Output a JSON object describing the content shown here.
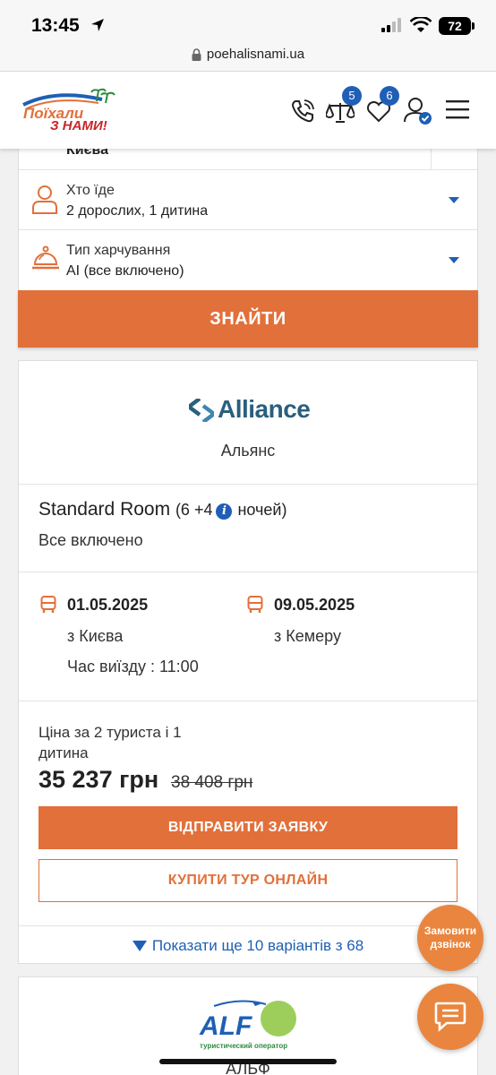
{
  "status_bar": {
    "time": "13:45",
    "battery": "72"
  },
  "url_bar": {
    "domain": "poehalisnami.ua"
  },
  "header": {
    "logo_text_line1": "Поїхали",
    "logo_text_line2": "з нами!",
    "compare_count": "5",
    "favorites_count": "6"
  },
  "search_form": {
    "departure_value": "Києва",
    "travelers": {
      "label": "Хто їде",
      "value": "2 дорослих, 1 дитина"
    },
    "meal": {
      "label": "Тип харчування",
      "value": "AI (все включено)"
    },
    "find_label": "ЗНАЙТИ"
  },
  "tour": {
    "operator_logo_text": "Alliance",
    "operator_name": "Альянс",
    "room": "Standard Room",
    "nights_prefix": "(6 +4",
    "nights_suffix": "ночей)",
    "meal": "Все включено",
    "departure": {
      "date": "01.05.2025",
      "city": "з Києва",
      "time": "Час виїзду : 11:00"
    },
    "return": {
      "date": "09.05.2025",
      "city": "з Кемеру"
    },
    "price_label": "Ціна за 2 туриста і 1 дитина",
    "price": "35 237 грн",
    "old_price": "38 408 грн",
    "request_label": "ВІДПРАВИТИ ЗАЯВКУ",
    "buy_label": "КУПИТИ ТУР ОНЛАЙН",
    "more_label": "Показати ще 10 варіантів з 68"
  },
  "next_card": {
    "logo_text": "ALF",
    "logo_subtext": "туристический оператор",
    "operator_name": "АЛЬФ"
  },
  "floating": {
    "callback_label_1": "Замовити",
    "callback_label_2": "дзвінок"
  },
  "colors": {
    "accent": "#e2703a",
    "link": "#1f5fb5"
  }
}
